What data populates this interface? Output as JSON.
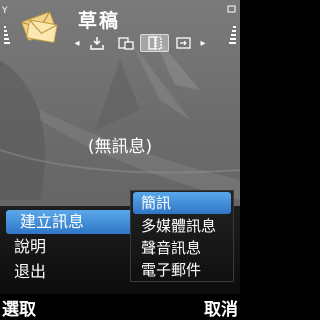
{
  "header": {
    "title": "草稿",
    "app_icon": "envelopes-icon",
    "signal_icon": "signal-strength-icon",
    "battery_icon": "battery-level-icon"
  },
  "folder_tabs": [
    {
      "icon": "inbox-icon",
      "active": false
    },
    {
      "icon": "folders-icon",
      "active": false
    },
    {
      "icon": "drafts-icon",
      "active": true
    },
    {
      "icon": "outbox-icon",
      "active": false
    }
  ],
  "main": {
    "empty_text": "(無訊息)"
  },
  "options_menu": {
    "items": [
      {
        "label": "建立訊息",
        "selected": true
      },
      {
        "label": "說明",
        "selected": false
      },
      {
        "label": "退出",
        "selected": false
      }
    ]
  },
  "submenu": {
    "items": [
      {
        "label": "簡訊",
        "selected": true
      },
      {
        "label": "多媒體訊息",
        "selected": false
      },
      {
        "label": "聲音訊息",
        "selected": false
      },
      {
        "label": "電子郵件",
        "selected": false
      }
    ]
  },
  "softkeys": {
    "left": "選取",
    "right": "取消"
  },
  "colors": {
    "highlight_top": "#5aa8ea",
    "highlight_bottom": "#2f76c7",
    "background": "#6c6c6c",
    "menu_bg": "#111111"
  }
}
